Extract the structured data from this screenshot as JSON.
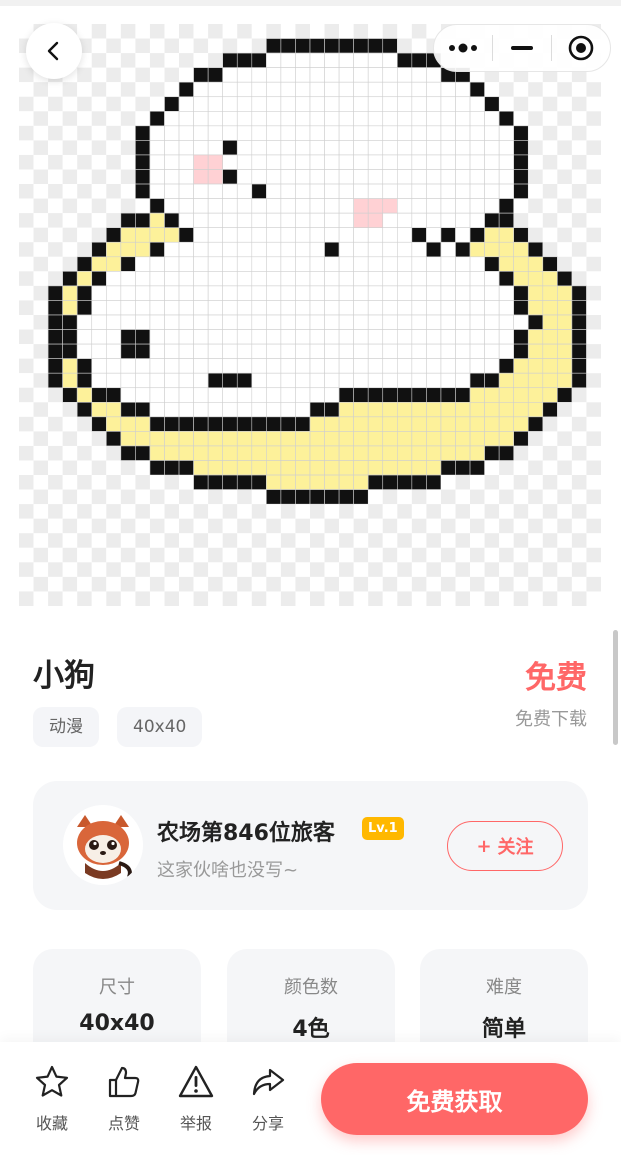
{
  "nav": {
    "back_icon": "chevron-left-icon",
    "more_icon": "more-dots-icon",
    "minimize_icon": "minimize-icon",
    "close_icon": "target-circle-icon"
  },
  "artwork": {
    "grid_size": "40x40",
    "palette": {
      "outline": "#111111",
      "fill": "#ffffff",
      "accent": "#fdf19a",
      "blush": "#ffd1d4",
      "checker_light": "#ffffff",
      "checker_dark": "#ececec"
    }
  },
  "product": {
    "title": "小狗",
    "price": "免费",
    "price_sub": "免费下载",
    "tags": [
      "动漫",
      "40x40"
    ]
  },
  "author": {
    "name": "农场第846位旅客",
    "level": "Lv.1",
    "bio": "这家伙啥也没写~",
    "follow_plus": "+",
    "follow_label": "关注",
    "avatar_icon": "red-panda-avatar"
  },
  "stats": [
    {
      "label": "尺寸",
      "value": "40x40"
    },
    {
      "label": "颜色数",
      "value": "4色"
    },
    {
      "label": "难度",
      "value": "简单"
    }
  ],
  "actions": [
    {
      "label": "收藏",
      "icon": "star-icon"
    },
    {
      "label": "点赞",
      "icon": "thumbs-up-icon"
    },
    {
      "label": "举报",
      "icon": "warning-icon"
    },
    {
      "label": "分享",
      "icon": "share-icon"
    }
  ],
  "cta": {
    "label": "免费获取"
  },
  "colors": {
    "accent": "#ff6767",
    "badge": "#ffb800",
    "card_bg": "#f5f6f8"
  }
}
